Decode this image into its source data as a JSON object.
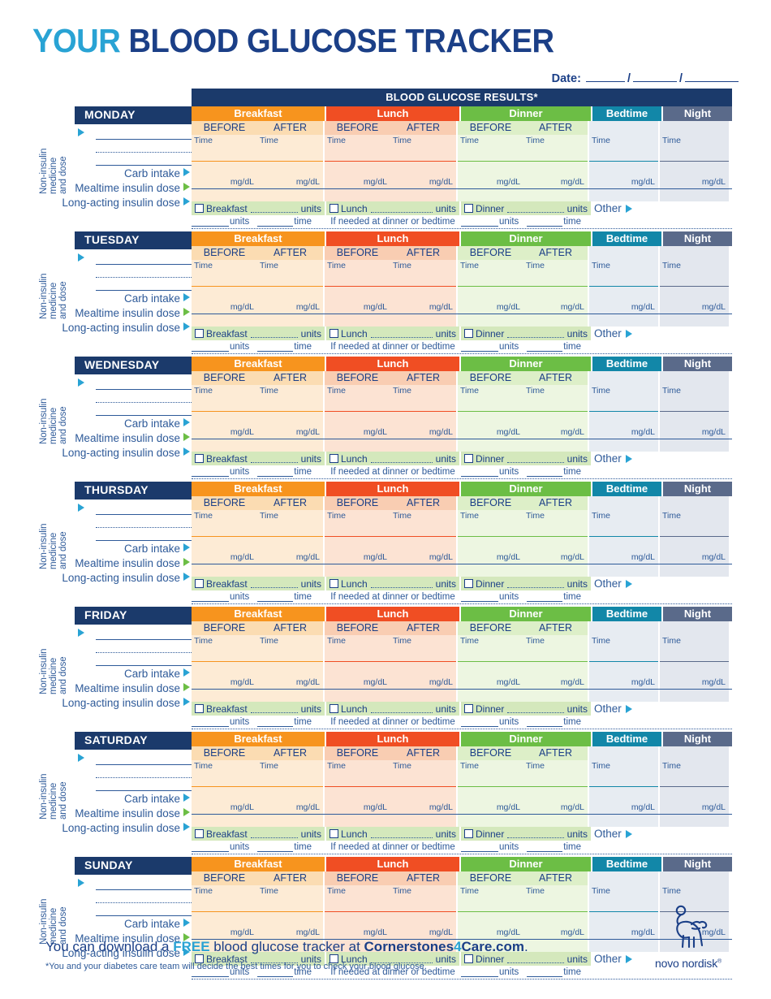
{
  "header": {
    "title_first": "YOUR",
    "title_rest": "BLOOD GLUCOSE TRACKER",
    "date_label": "Date:",
    "slash": "/",
    "grid_title": "BLOOD GLUCOSE RESULTS*"
  },
  "colors": {
    "navy": "#1B3A6B",
    "blue_text": "#1B3F87",
    "light_blue": "#29A3D4",
    "breakfast": "#F7941E",
    "lunch": "#F04E23",
    "dinner": "#6CBE45",
    "bedtime": "#1287A8",
    "night": "#5A6A8A"
  },
  "columns": {
    "breakfast": "Breakfast",
    "lunch": "Lunch",
    "dinner": "Dinner",
    "bedtime": "Bedtime",
    "night": "Night",
    "before": "BEFORE",
    "after": "AFTER",
    "time": "Time",
    "unit": "mg/dL"
  },
  "left_labels": {
    "vertical_line1": "Non-insulin",
    "vertical_line2": "medicine",
    "vertical_line3": "and dose",
    "carb_intake": "Carb intake",
    "mealtime_insulin": "Mealtime insulin dose",
    "long_acting_insulin": "Long-acting insulin dose"
  },
  "insulin_row": {
    "breakfast_label": "Breakfast",
    "lunch_label": "Lunch",
    "dinner_label": "Dinner",
    "units": "units",
    "other": "Other"
  },
  "long_acting_row": {
    "units": "units",
    "time": "time",
    "if_needed": "If needed at dinner or bedtime"
  },
  "days": [
    {
      "name": "MONDAY"
    },
    {
      "name": "TUESDAY"
    },
    {
      "name": "WEDNESDAY"
    },
    {
      "name": "THURSDAY"
    },
    {
      "name": "FRIDAY"
    },
    {
      "name": "SATURDAY"
    },
    {
      "name": "SUNDAY"
    }
  ],
  "footer": {
    "line1_a": "You can download a ",
    "line1_free": "FREE",
    "line1_b": " blood glucose tracker at ",
    "site_a": "Cornerstones",
    "site_four": "4",
    "site_b": "Care.com",
    "line1_end": ".",
    "line2": "*You and your diabetes care team will decide the best times for you to check your blood glucose.",
    "logo_name": "novo nordisk",
    "logo_reg": "®"
  }
}
